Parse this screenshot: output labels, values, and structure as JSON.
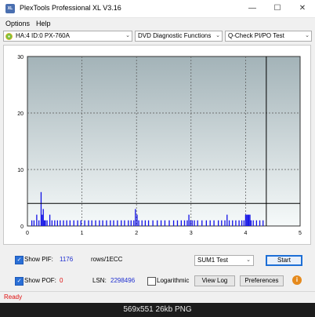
{
  "window": {
    "title": "PlexTools Professional XL V3.16",
    "icon_text": "XL",
    "minimize": "—",
    "maximize": "☐",
    "close": "✕"
  },
  "menu": {
    "options": "Options",
    "help": "Help"
  },
  "toolbar": {
    "drive": "HA:4 ID:0  PX-760A",
    "function": "DVD Diagnostic Functions",
    "test": "Q-Check PI/PO Test",
    "arrow": "⌄"
  },
  "chart_data": {
    "type": "bar",
    "title": "",
    "xlabel": "",
    "ylabel": "",
    "xlim": [
      0,
      5
    ],
    "ylim": [
      0,
      30
    ],
    "x_ticks": [
      0,
      1,
      2,
      3,
      4,
      5
    ],
    "y_ticks": [
      0,
      10,
      20,
      30
    ],
    "grid": true,
    "threshold_line": 4,
    "end_marker_x": 4.38,
    "colors": {
      "plot_bg_top": "#a3b3b8",
      "plot_bg_bottom": "#f6fafa",
      "bars": "#1010e6",
      "threshold": "#000000",
      "grid": "#555555"
    },
    "bars": [
      [
        0.08,
        1
      ],
      [
        0.12,
        1
      ],
      [
        0.17,
        2
      ],
      [
        0.21,
        1
      ],
      [
        0.25,
        6
      ],
      [
        0.27,
        2
      ],
      [
        0.29,
        3
      ],
      [
        0.31,
        1
      ],
      [
        0.33,
        1
      ],
      [
        0.36,
        1
      ],
      [
        0.41,
        2
      ],
      [
        0.45,
        1
      ],
      [
        0.5,
        1
      ],
      [
        0.55,
        1
      ],
      [
        0.6,
        1
      ],
      [
        0.66,
        1
      ],
      [
        0.72,
        1
      ],
      [
        0.78,
        1
      ],
      [
        0.85,
        1
      ],
      [
        0.92,
        1
      ],
      [
        0.98,
        1
      ],
      [
        1.05,
        1
      ],
      [
        1.12,
        1
      ],
      [
        1.18,
        1
      ],
      [
        1.25,
        1
      ],
      [
        1.32,
        1
      ],
      [
        1.38,
        1
      ],
      [
        1.45,
        1
      ],
      [
        1.52,
        1
      ],
      [
        1.58,
        1
      ],
      [
        1.65,
        1
      ],
      [
        1.72,
        1
      ],
      [
        1.78,
        1
      ],
      [
        1.85,
        1
      ],
      [
        1.9,
        1
      ],
      [
        1.95,
        1
      ],
      [
        1.98,
        3
      ],
      [
        2.01,
        2
      ],
      [
        2.04,
        1
      ],
      [
        2.1,
        1
      ],
      [
        2.16,
        1
      ],
      [
        2.22,
        1
      ],
      [
        2.3,
        1
      ],
      [
        2.38,
        1
      ],
      [
        2.45,
        1
      ],
      [
        2.52,
        1
      ],
      [
        2.6,
        1
      ],
      [
        2.68,
        1
      ],
      [
        2.75,
        1
      ],
      [
        2.82,
        1
      ],
      [
        2.88,
        1
      ],
      [
        2.93,
        1
      ],
      [
        2.96,
        2
      ],
      [
        2.99,
        1
      ],
      [
        3.02,
        1
      ],
      [
        3.06,
        1
      ],
      [
        3.12,
        1
      ],
      [
        3.2,
        1
      ],
      [
        3.28,
        1
      ],
      [
        3.35,
        1
      ],
      [
        3.42,
        1
      ],
      [
        3.5,
        1
      ],
      [
        3.56,
        1
      ],
      [
        3.62,
        1
      ],
      [
        3.66,
        2
      ],
      [
        3.7,
        1
      ],
      [
        3.76,
        1
      ],
      [
        3.82,
        1
      ],
      [
        3.88,
        1
      ],
      [
        3.93,
        1
      ],
      [
        3.97,
        1
      ],
      [
        4.0,
        2
      ],
      [
        4.02,
        2
      ],
      [
        4.04,
        2
      ],
      [
        4.06,
        2
      ],
      [
        4.08,
        2
      ],
      [
        4.1,
        1
      ],
      [
        4.14,
        1
      ],
      [
        4.2,
        1
      ],
      [
        4.26,
        1
      ],
      [
        4.32,
        1
      ]
    ]
  },
  "controls": {
    "show_pif_label": "Show PIF:",
    "pif_value": "1176",
    "rows_label": "rows/1ECC",
    "sum_test": "SUM1 Test",
    "start": "Start",
    "show_pof_label": "Show POF:",
    "pof_value": "0",
    "lsn_label": "LSN:",
    "lsn_value": "2298496",
    "logarithmic": "Logarithmic",
    "view_log": "View Log",
    "preferences": "Preferences",
    "check_mark": "✓",
    "info": "i"
  },
  "status": {
    "text": "Ready"
  },
  "caption": {
    "text": "569x551  26kb  PNG"
  }
}
